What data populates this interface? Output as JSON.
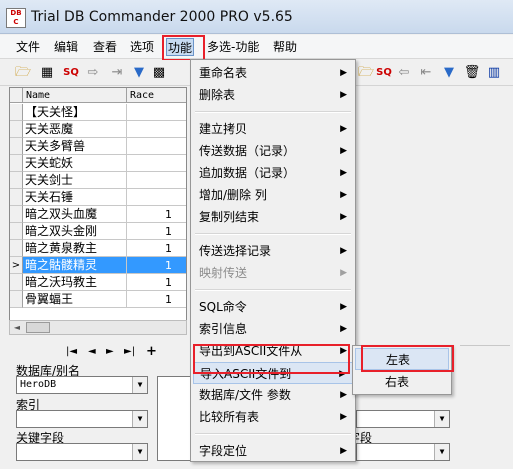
{
  "window": {
    "title": "Trial DB Commander 2000 PRO v5.65",
    "icon_text": "DB C"
  },
  "menubar": {
    "items": [
      "文件",
      "编辑",
      "查看",
      "选项",
      "功能",
      "多选-功能",
      "帮助"
    ]
  },
  "toolbar_icons": [
    "folder-open-icon",
    "table-icon",
    "sql-icon",
    "arrow-right-icon",
    "export-icon",
    "filter-icon",
    "grid-icon",
    "delete-icon",
    "table-settings-icon"
  ],
  "grid": {
    "columns": [
      "Name",
      "Race"
    ],
    "rows": [
      {
        "name": "【天关怪】",
        "race": ""
      },
      {
        "name": "天关恶魔",
        "race": ""
      },
      {
        "name": "天关多臂兽",
        "race": ""
      },
      {
        "name": "天关蛇妖",
        "race": ""
      },
      {
        "name": "天关剑士",
        "race": ""
      },
      {
        "name": "天关石锤",
        "race": ""
      },
      {
        "name": "暗之双头血魔",
        "race": "1"
      },
      {
        "name": "暗之双头金刚",
        "race": "1"
      },
      {
        "name": "暗之黄泉教主",
        "race": "1"
      },
      {
        "name": "暗之骷髅精灵",
        "race": "1"
      },
      {
        "name": "暗之沃玛教主",
        "race": "1"
      },
      {
        "name": "骨翼蝠王",
        "race": "1"
      }
    ],
    "selected_row": 9,
    "current_indicator": ">"
  },
  "navigator": {
    "buttons": [
      "|◄",
      "◄",
      "►",
      "►|",
      "+"
    ]
  },
  "left_panel": {
    "db_alias_label": "数据库/别名",
    "db_alias_value": "HeroDB",
    "index_label": "索引",
    "index_value": "",
    "key_field_label": "关键字段",
    "key_field_value": ""
  },
  "right_panel": {
    "key_field_label_partial": "字段"
  },
  "func_menu": {
    "items": [
      {
        "label": "重命名表",
        "has_submenu": true,
        "disabled": false
      },
      {
        "label": "删除表",
        "has_submenu": true,
        "disabled": false
      },
      {
        "sep": true
      },
      {
        "label": "建立拷贝",
        "has_submenu": true,
        "disabled": false
      },
      {
        "label": "传送数据（记录）",
        "has_submenu": true,
        "disabled": false
      },
      {
        "label": "追加数据（记录）",
        "has_submenu": true,
        "disabled": false
      },
      {
        "label": "增加/删除 列",
        "has_submenu": true,
        "disabled": false
      },
      {
        "label": "复制列结束",
        "has_submenu": true,
        "disabled": false
      },
      {
        "sep": true
      },
      {
        "label": "传送选择记录",
        "has_submenu": true,
        "disabled": false
      },
      {
        "label": "映射传送",
        "has_submenu": true,
        "disabled": true
      },
      {
        "sep": true
      },
      {
        "label": "SQL命令",
        "has_submenu": true,
        "disabled": false
      },
      {
        "label": "索引信息",
        "has_submenu": true,
        "disabled": false
      },
      {
        "label": "导出到ASCII文件从",
        "has_submenu": true,
        "disabled": false
      },
      {
        "label": "导入ASCII文件到",
        "has_submenu": true,
        "disabled": false,
        "hover": true
      },
      {
        "label": "数据库/文件 参数",
        "has_submenu": true,
        "disabled": false
      },
      {
        "label": "比较所有表",
        "has_submenu": true,
        "disabled": false
      },
      {
        "sep": true
      },
      {
        "label": "字段定位",
        "has_submenu": true,
        "disabled": false
      }
    ]
  },
  "sub_menu": {
    "items": [
      {
        "label": "左表",
        "hover": true
      },
      {
        "label": "右表",
        "hover": false
      }
    ]
  },
  "colors": {
    "highlight_red": "#e8202a",
    "selection_blue": "#3399ff",
    "menu_hover": "#dbe6f4"
  }
}
